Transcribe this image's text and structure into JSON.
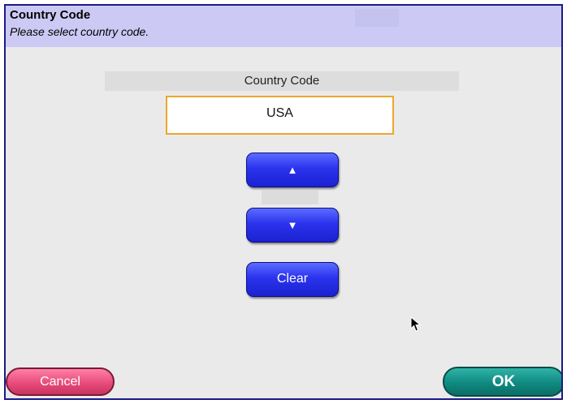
{
  "header": {
    "title": "Country Code",
    "subtitle": "Please select country code."
  },
  "field": {
    "label": "Country Code",
    "value": "USA"
  },
  "controls": {
    "up_glyph": "▲",
    "up_icon": "up-arrow-icon",
    "down_glyph": "▼",
    "down_icon": "down-arrow-icon",
    "clear_label": "Clear"
  },
  "footer": {
    "cancel_label": "Cancel",
    "ok_label": "OK"
  },
  "colors": {
    "header_bg": "#cccaf4",
    "window_border": "#1a1a88",
    "value_border": "#f0a52c",
    "blue_button": "#2b33ee",
    "cancel_button": "#e84c7c",
    "ok_button": "#108a80"
  }
}
